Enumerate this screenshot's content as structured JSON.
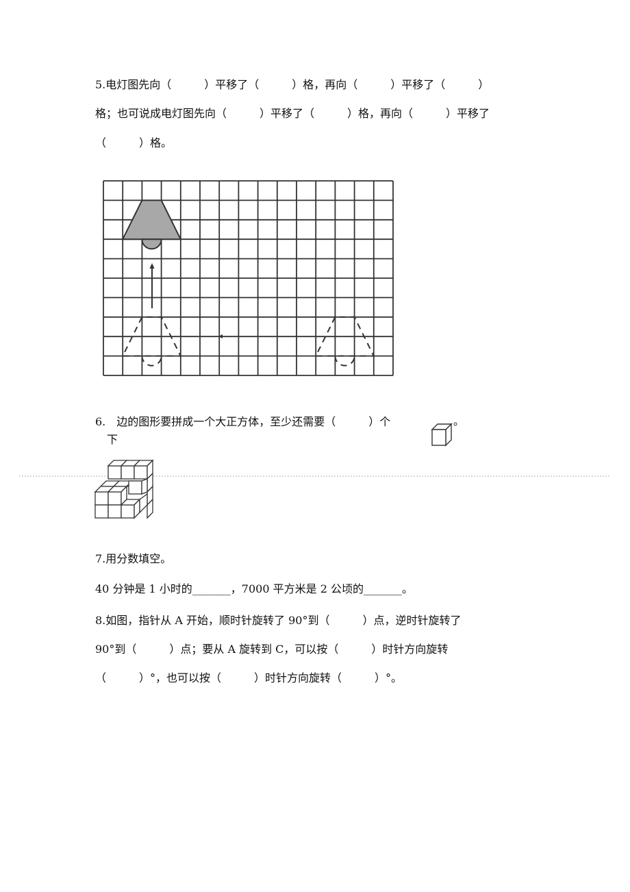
{
  "q5": {
    "line1": "5.电灯图先向（　　　）平移了（　　　）格，再向（　　　）平移了（　　　）",
    "line2": "格；也可说成电灯图先向（　　　）平移了（　　　）格，再向（　　　）平移了",
    "line3": "（　　　）格。",
    "grid": {
      "columns": 15,
      "rows": 10,
      "fill_color": "#a8a8a8",
      "line_color": "#333333"
    }
  },
  "q6": {
    "line1_prefix": "6.",
    "line1_text": "边的图形要拼成一个大正方体，至少还需要（　　　）个",
    "line1_suffix": "。",
    "line2": "下"
  },
  "q7": {
    "title": "7.用分数填空。",
    "line": "40 分钟是 1 小时的_______，7000 平方米是 2 公顷的_______。"
  },
  "q8": {
    "line1": "8.如图，指针从 A 开始，顺时针旋转了 90°到（　　　）点，逆时针旋转了",
    "line2": "90°到（　　　）点；要从 A 旋转到 C，可以按（　　　）时针方向旋转",
    "line3": "（　　　）°，也可以按（　　　）时针方向旋转（　　　）°。"
  }
}
